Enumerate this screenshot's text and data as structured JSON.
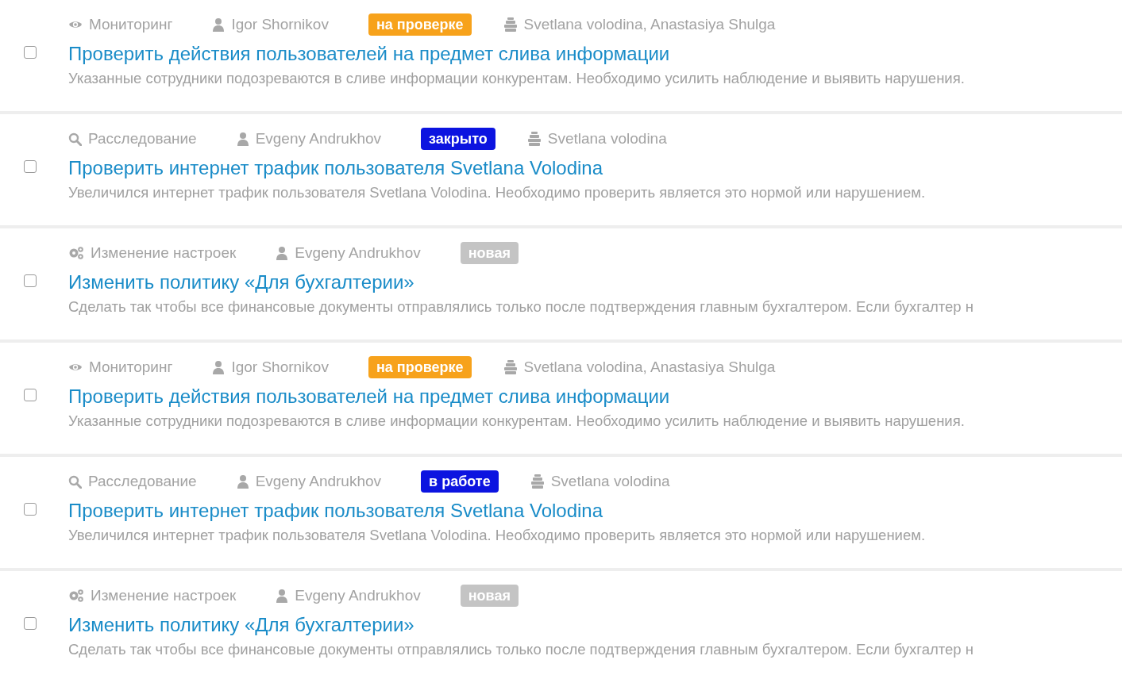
{
  "tasks": [
    {
      "checked": false,
      "category": {
        "kind": "monitoring",
        "label": "Мониторинг"
      },
      "author": "Igor Shornikov",
      "status": {
        "label": "на проверке",
        "color": "#f7a21b"
      },
      "observers": "Svetlana volodina, Anastasiya Shulga",
      "title": "Проверить действия пользователей на предмет слива информации",
      "description": "Указанные сотрудники подозреваются в сливе информации конкурентам. Необходимо усилить наблюдение и выявить  нарушения."
    },
    {
      "checked": false,
      "category": {
        "kind": "investigation",
        "label": "Расследование"
      },
      "author": "Evgeny Andrukhov",
      "status": {
        "label": "закрыто",
        "color": "#0c14e0"
      },
      "observers": "Svetlana volodina",
      "title": "Проверить интернет трафик пользователя Svetlana Volodina",
      "description": "Увеличился интернет трафик пользователя Svetlana Volodina. Необходимо проверить является это нормой или нарушением."
    },
    {
      "checked": false,
      "category": {
        "kind": "settings",
        "label": "Изменение настроек"
      },
      "author": "Evgeny Andrukhov",
      "status": {
        "label": "новая",
        "color": "#c4c4c4"
      },
      "title": "Изменить политику «Для бухгалтерии»",
      "description": "Сделать так чтобы все финансовые документы отправлялись только после подтверждения главным бухгалтером. Если бухгалтер н"
    },
    {
      "checked": false,
      "category": {
        "kind": "monitoring",
        "label": "Мониторинг"
      },
      "author": "Igor Shornikov",
      "status": {
        "label": "на проверке",
        "color": "#f7a21b"
      },
      "observers": "Svetlana volodina, Anastasiya Shulga",
      "title": "Проверить действия пользователей на предмет слива информации",
      "description": "Указанные сотрудники подозреваются в сливе информации конкурентам. Необходимо усилить наблюдение и выявить  нарушения."
    },
    {
      "checked": false,
      "category": {
        "kind": "investigation",
        "label": "Расследование"
      },
      "author": "Evgeny Andrukhov",
      "status": {
        "label": "в работе",
        "color": "#0c14e0"
      },
      "observers": "Svetlana volodina",
      "title": "Проверить интернет трафик пользователя Svetlana Volodina",
      "description": "Увеличился интернет трафик пользователя Svetlana Volodina. Необходимо проверить является это нормой или нарушением."
    },
    {
      "checked": false,
      "category": {
        "kind": "settings",
        "label": "Изменение настроек"
      },
      "author": "Evgeny Andrukhov",
      "status": {
        "label": "новая",
        "color": "#c4c4c4"
      },
      "title": "Изменить политику «Для бухгалтерии»",
      "description": "Сделать так чтобы все финансовые документы отправлялись только после подтверждения главным бухгалтером. Если бухгалтер н"
    }
  ]
}
